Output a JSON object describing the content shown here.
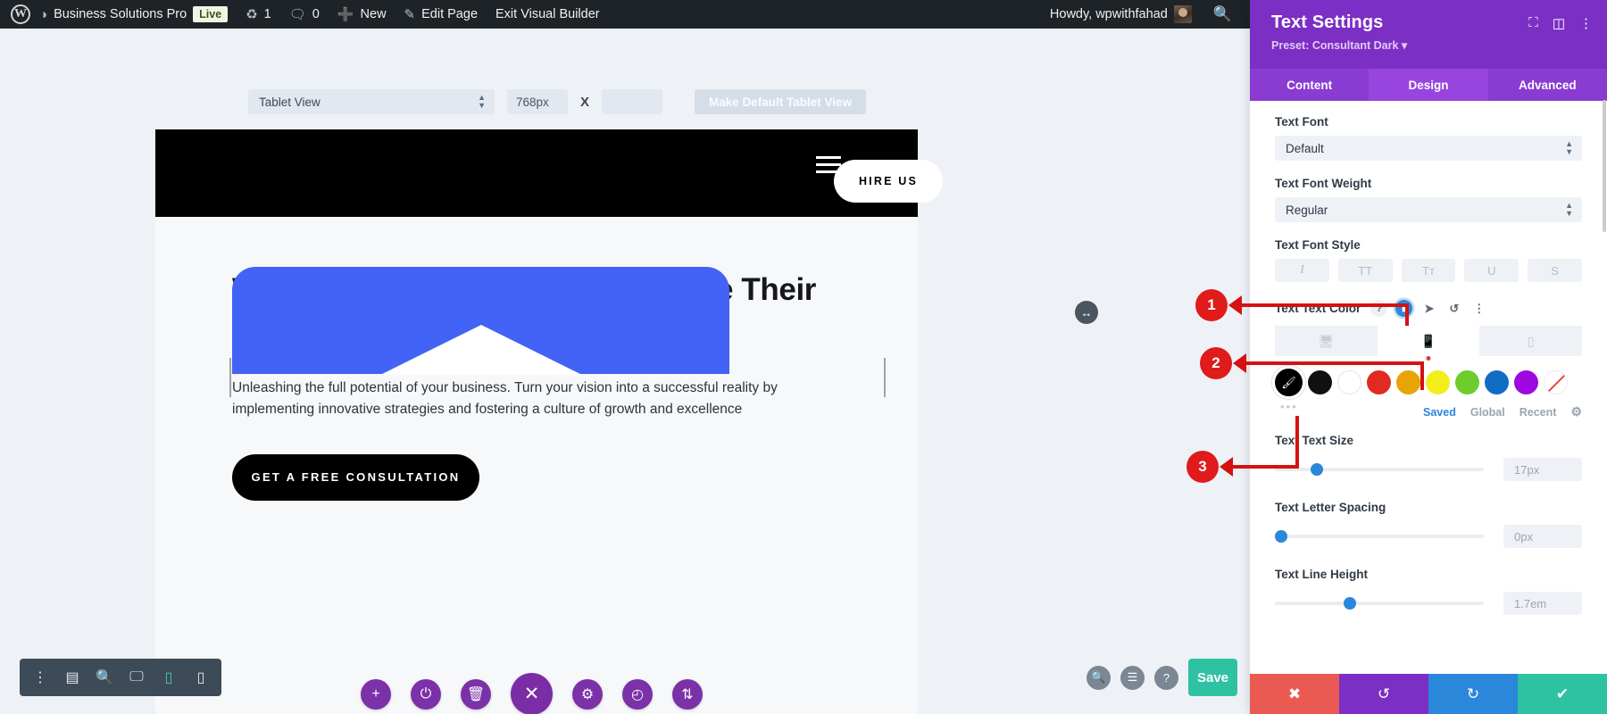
{
  "adminbar": {
    "logo_icon": "wordpress-logo-icon",
    "site_name": "Business Solutions Pro",
    "live_badge": "Live",
    "updates_icon": "updates-icon",
    "updates_count": "1",
    "comments_icon": "comments-icon",
    "comments_count": "0",
    "new_icon": "plus-icon",
    "new_label": "New",
    "edit_icon": "pencil-icon",
    "edit_label": "Edit Page",
    "exit_label": "Exit Visual Builder",
    "howdy": "Howdy, wpwithfahad",
    "avatar_icon": "avatar",
    "search_icon": "search-icon"
  },
  "viewport_toolbar": {
    "view_select": "Tablet View",
    "view_caret_icon": "updown-caret-icon",
    "width_value": "768px",
    "x_label": "X",
    "height_value": "",
    "make_default": "Make Default Tablet View"
  },
  "site_preview": {
    "menu_icon": "hamburger-menu-icon",
    "hire_button": "HIRE US",
    "heading": "We Empower Businesses to Forge Their Own Paths",
    "paragraph": "Unleashing the full potential of your business. Turn your vision into a successful reality by implementing innovative strategies and fostering a culture of growth and excellence",
    "cta_button": "GET A FREE CONSULTATION",
    "card_color": "#4263f5"
  },
  "module_actions": [
    {
      "name": "add-module-button",
      "icon": "plus-icon",
      "glyph": "+"
    },
    {
      "name": "toggle-module-button",
      "icon": "power-icon",
      "glyph": "⏻"
    },
    {
      "name": "delete-module-button",
      "icon": "trash-icon",
      "glyph": "🗑"
    },
    {
      "name": "close-module-button",
      "icon": "close-x-icon",
      "glyph": "✕"
    },
    {
      "name": "module-settings-button",
      "icon": "gear-icon",
      "glyph": "⚙"
    },
    {
      "name": "module-history-button",
      "icon": "clock-icon",
      "glyph": "◴"
    },
    {
      "name": "module-reorder-button",
      "icon": "sort-updown-icon",
      "glyph": "⇅"
    }
  ],
  "bottom_left_toolbar": [
    {
      "name": "more-options-button",
      "icon": "vertical-dots-icon",
      "glyph": "⋮"
    },
    {
      "name": "wireframe-view-button",
      "icon": "wireframe-icon",
      "glyph": "▤"
    },
    {
      "name": "zoom-out-view-button",
      "icon": "magnifier-plus-icon",
      "glyph": "🔍"
    },
    {
      "name": "desktop-view-button",
      "icon": "desktop-icon",
      "glyph": "🖵"
    },
    {
      "name": "tablet-view-button",
      "icon": "tablet-icon",
      "glyph": "▯",
      "active": true
    },
    {
      "name": "phone-view-button",
      "icon": "phone-icon",
      "glyph": "▯"
    }
  ],
  "bottom_right": {
    "search_icon": "magnifier-icon",
    "layers_icon": "layers-icon",
    "help_icon": "question-mark-icon",
    "save_label": "Save",
    "save_color": "#2ec2a3"
  },
  "resize_handle_icon": "horizontal-resize-icon",
  "panel": {
    "title": "Text Settings",
    "preset": "Preset: Consultant Dark",
    "preset_caret_icon": "caret-down-icon",
    "head_icons": [
      {
        "name": "fullscreen-icon",
        "glyph": "⛶"
      },
      {
        "name": "split-layout-icon",
        "glyph": "◫"
      },
      {
        "name": "vertical-dots-icon",
        "glyph": "⋮"
      }
    ],
    "tabs": [
      {
        "label": "Content",
        "selected": false
      },
      {
        "label": "Design",
        "selected": true
      },
      {
        "label": "Advanced",
        "selected": false
      }
    ],
    "fields": {
      "text_font_label": "Text Font",
      "text_font_value": "Default",
      "text_font_weight_label": "Text Font Weight",
      "text_font_weight_value": "Regular",
      "text_font_style_label": "Text Font Style",
      "style_buttons": [
        {
          "name": "italic-style-button",
          "glyph": "I"
        },
        {
          "name": "uppercase-style-button",
          "glyph": "TT"
        },
        {
          "name": "smallcaps-style-button",
          "glyph": "Tт"
        },
        {
          "name": "underline-style-button",
          "glyph": "U"
        },
        {
          "name": "strikethrough-style-button",
          "glyph": "S"
        }
      ],
      "text_color_label": "Text Text Color",
      "color_header_icons": [
        {
          "name": "help-icon",
          "glyph": "?"
        },
        {
          "name": "responsive-phone-icon",
          "glyph": "▯",
          "active": true
        },
        {
          "name": "hover-cursor-icon",
          "glyph": "➤"
        },
        {
          "name": "reset-icon",
          "glyph": "↺"
        },
        {
          "name": "vertical-dots-icon",
          "glyph": "⋮"
        }
      ],
      "device_tabs": [
        {
          "name": "device-tab-desktop",
          "icon": "desktop-icon",
          "glyph": "🖵",
          "selected": false
        },
        {
          "name": "device-tab-tablet",
          "icon": "tablet-icon",
          "glyph": "▯",
          "selected": true
        },
        {
          "name": "device-tab-phone",
          "icon": "phone-icon",
          "glyph": "▐",
          "selected": false
        }
      ],
      "swatches": [
        {
          "name": "color-picker-button",
          "icon": "eyedropper-icon",
          "hex": "#000000",
          "kind": "picker"
        },
        {
          "name": "swatch-black",
          "hex": "#111111",
          "kind": "solid"
        },
        {
          "name": "swatch-white",
          "hex": "#ffffff",
          "kind": "white"
        },
        {
          "name": "swatch-red",
          "hex": "#e02b20",
          "kind": "solid"
        },
        {
          "name": "swatch-orange",
          "hex": "#e8a305",
          "kind": "solid"
        },
        {
          "name": "swatch-yellow",
          "hex": "#f2ee1a",
          "kind": "solid"
        },
        {
          "name": "swatch-green",
          "hex": "#6ecc2c",
          "kind": "solid"
        },
        {
          "name": "swatch-blue",
          "hex": "#116dc4",
          "kind": "solid"
        },
        {
          "name": "swatch-purple",
          "hex": "#9d07e0",
          "kind": "solid"
        },
        {
          "name": "swatch-transparent",
          "hex": "none",
          "kind": "none"
        }
      ],
      "swatch_more_icon": "three-dots-icon",
      "palette_tabs": [
        {
          "label": "Saved",
          "selected": true
        },
        {
          "label": "Global",
          "selected": false
        },
        {
          "label": "Recent",
          "selected": false
        }
      ],
      "palette_settings_icon": "gear-icon",
      "text_size_label": "Text Text Size",
      "text_size_value": "17px",
      "text_size_knob_pct": 18,
      "letter_spacing_label": "Text Letter Spacing",
      "letter_spacing_value": "0px",
      "letter_spacing_knob_pct": 1,
      "line_height_label": "Text Line Height",
      "line_height_value": "1.7em",
      "line_height_knob_pct": 34
    },
    "footer_buttons": [
      {
        "name": "cancel-button",
        "icon": "close-x-icon",
        "glyph": "✖",
        "color": "#ea5a52"
      },
      {
        "name": "undo-button",
        "icon": "undo-arrow-icon",
        "glyph": "↺",
        "color": "#7c2fc4"
      },
      {
        "name": "redo-button",
        "icon": "redo-arrow-icon",
        "glyph": "↻",
        "color": "#2b87da"
      },
      {
        "name": "save-check-button",
        "icon": "checkmark-icon",
        "glyph": "✔",
        "color": "#2ec2a3"
      }
    ]
  },
  "annotations": [
    {
      "number": "1"
    },
    {
      "number": "2"
    },
    {
      "number": "3"
    }
  ]
}
